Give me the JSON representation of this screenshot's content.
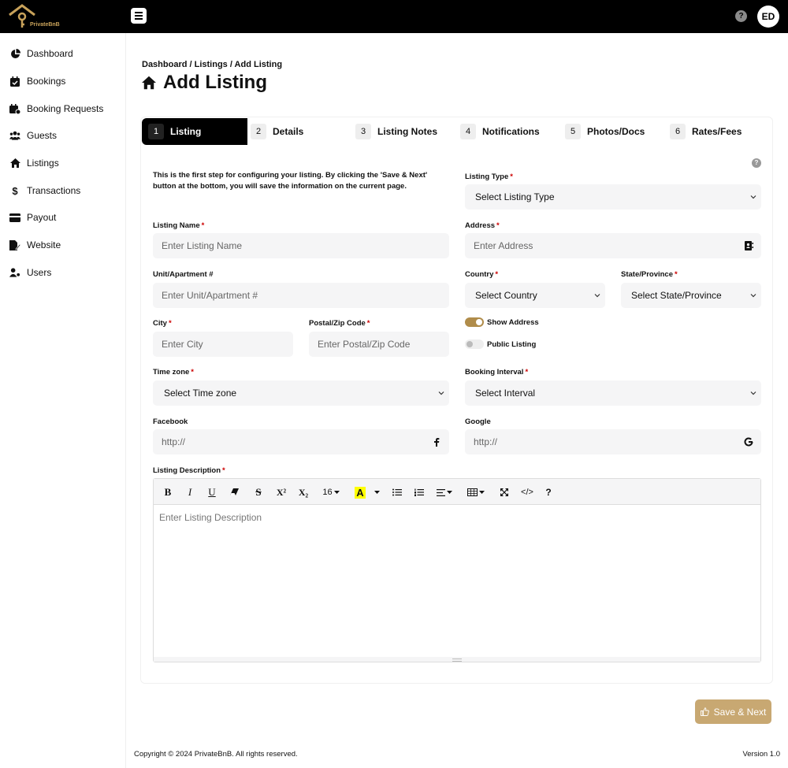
{
  "app": {
    "logo_text": "PrivateBnB",
    "user_initials": "ED",
    "help_glyph": "?"
  },
  "sidebar": {
    "items": [
      {
        "label": "Dashboard",
        "icon": "chart-pie-icon"
      },
      {
        "label": "Bookings",
        "icon": "calendar-check-icon"
      },
      {
        "label": "Booking Requests",
        "icon": "calendar-plus-icon"
      },
      {
        "label": "Guests",
        "icon": "users-icon"
      },
      {
        "label": "Listings",
        "icon": "home-icon"
      },
      {
        "label": "Transactions",
        "icon": "dollar-icon"
      },
      {
        "label": "Payout",
        "icon": "credit-card-icon"
      },
      {
        "label": "Website",
        "icon": "file-edit-icon"
      },
      {
        "label": "Users",
        "icon": "user-cog-icon"
      }
    ]
  },
  "header": {
    "breadcrumb": "Dashboard / Listings / Add Listing",
    "title": "Add Listing"
  },
  "tabs": [
    {
      "num": "1",
      "label": "Listing",
      "active": true
    },
    {
      "num": "2",
      "label": "Details"
    },
    {
      "num": "3",
      "label": "Listing Notes"
    },
    {
      "num": "4",
      "label": "Notifications"
    },
    {
      "num": "5",
      "label": "Photos/Docs"
    },
    {
      "num": "6",
      "label": "Rates/Fees"
    }
  ],
  "form": {
    "intro": "This is the first step for configuring your listing. By clicking the 'Save & Next' button at the bottom, you will save the information on the current page.",
    "required_mark": "*",
    "listing_type": {
      "label": "Listing Type",
      "value": "Select Listing Type"
    },
    "listing_name": {
      "label": "Listing Name",
      "placeholder": "Enter Listing Name"
    },
    "address": {
      "label": "Address",
      "placeholder": "Enter Address"
    },
    "unit": {
      "label": "Unit/Apartment #",
      "placeholder": "Enter Unit/Apartment #"
    },
    "country": {
      "label": "Country",
      "value": "Select Country"
    },
    "state": {
      "label": "State/Province",
      "value": "Select State/Province"
    },
    "city": {
      "label": "City",
      "placeholder": "Enter City"
    },
    "postal": {
      "label": "Postal/Zip Code",
      "placeholder": "Enter Postal/Zip Code"
    },
    "show_address": {
      "label": "Show Address",
      "on": true
    },
    "public_listing": {
      "label": "Public Listing",
      "on": false
    },
    "timezone": {
      "label": "Time zone",
      "value": "Select Time zone"
    },
    "booking_interval": {
      "label": "Booking Interval",
      "value": "Select Interval"
    },
    "facebook": {
      "label": "Facebook",
      "placeholder": "http://"
    },
    "google": {
      "label": "Google",
      "placeholder": "http://"
    },
    "description": {
      "label": "Listing Description",
      "placeholder": "Enter Listing Description",
      "font_size": "16"
    }
  },
  "editor_toolbar": {
    "bold": "B",
    "italic": "I",
    "underline": "U",
    "strike": "S",
    "superscript": "X²",
    "subscript": "X₂",
    "highlight": "A",
    "code": "</>",
    "help": "?"
  },
  "actions": {
    "save_next": "Save & Next"
  },
  "footer": {
    "copyright": "Copyright © 2024 PrivateBnB. All rights reserved.",
    "version": "Version 1.0"
  },
  "colors": {
    "accent_gold": "#b08c4a",
    "button_gold": "#c8a872",
    "topbar": "#000000",
    "required": "#cc0000"
  }
}
